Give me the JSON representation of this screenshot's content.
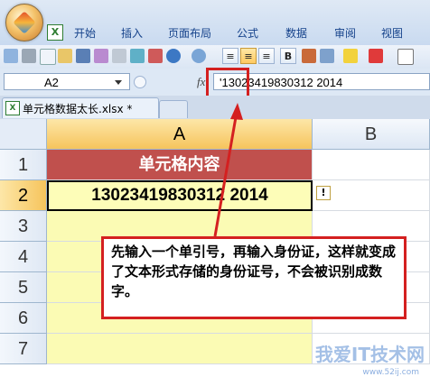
{
  "ribbon": {
    "tabs": [
      "开始",
      "插入",
      "页面布局",
      "公式",
      "数据",
      "审阅",
      "视图"
    ]
  },
  "formula_bar": {
    "name_box": "A2",
    "fx_symbol": "fx",
    "formula": "'13023419830312 2014"
  },
  "workbook": {
    "tab_label": "单元格数据太长.xlsx *"
  },
  "sheet": {
    "columns": [
      "A",
      "B"
    ],
    "rows": [
      "1",
      "2",
      "3",
      "4",
      "5",
      "6",
      "7"
    ],
    "header_cell": "单元格内容",
    "value_cell": "13023419830312 2014",
    "warning_symbol": "!"
  },
  "callout": {
    "text": "先输入一个单引号，再输入身份证，这样就变成了文本形式存储的身份证号，不会被识别成数字。"
  },
  "watermark": {
    "text": "我爱IT技术网",
    "url": "www.52ij.com"
  },
  "colors": {
    "header_fill": "#c0504d",
    "highlight": "#d42020",
    "cell_fill": "#fbfbb4"
  }
}
